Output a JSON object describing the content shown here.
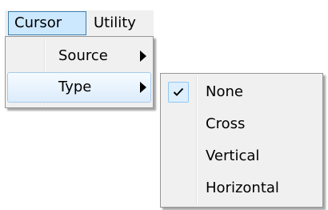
{
  "menubar": {
    "items": [
      {
        "label": "Cursor",
        "state": "open"
      },
      {
        "label": "Utility"
      }
    ]
  },
  "cursor_menu": {
    "items": [
      {
        "label": "Source",
        "has_submenu": true
      },
      {
        "label": "Type",
        "has_submenu": true,
        "state": "highlighted"
      }
    ]
  },
  "type_submenu": {
    "items": [
      {
        "label": "None",
        "checked": true
      },
      {
        "label": "Cross",
        "checked": false
      },
      {
        "label": "Vertical",
        "checked": false
      },
      {
        "label": "Horizontal",
        "checked": false
      }
    ]
  },
  "icons": {
    "submenu_arrow": "triangle-right-icon",
    "check": "checkmark-icon"
  },
  "colors": {
    "menu_bg": "#f0f0f0",
    "open_item_bg": "#cce8ff",
    "open_item_border": "#3c7fb1",
    "highlight_border": "#a8cbea",
    "check_bg": "#ddeefc",
    "check_border": "#90c8f6"
  }
}
